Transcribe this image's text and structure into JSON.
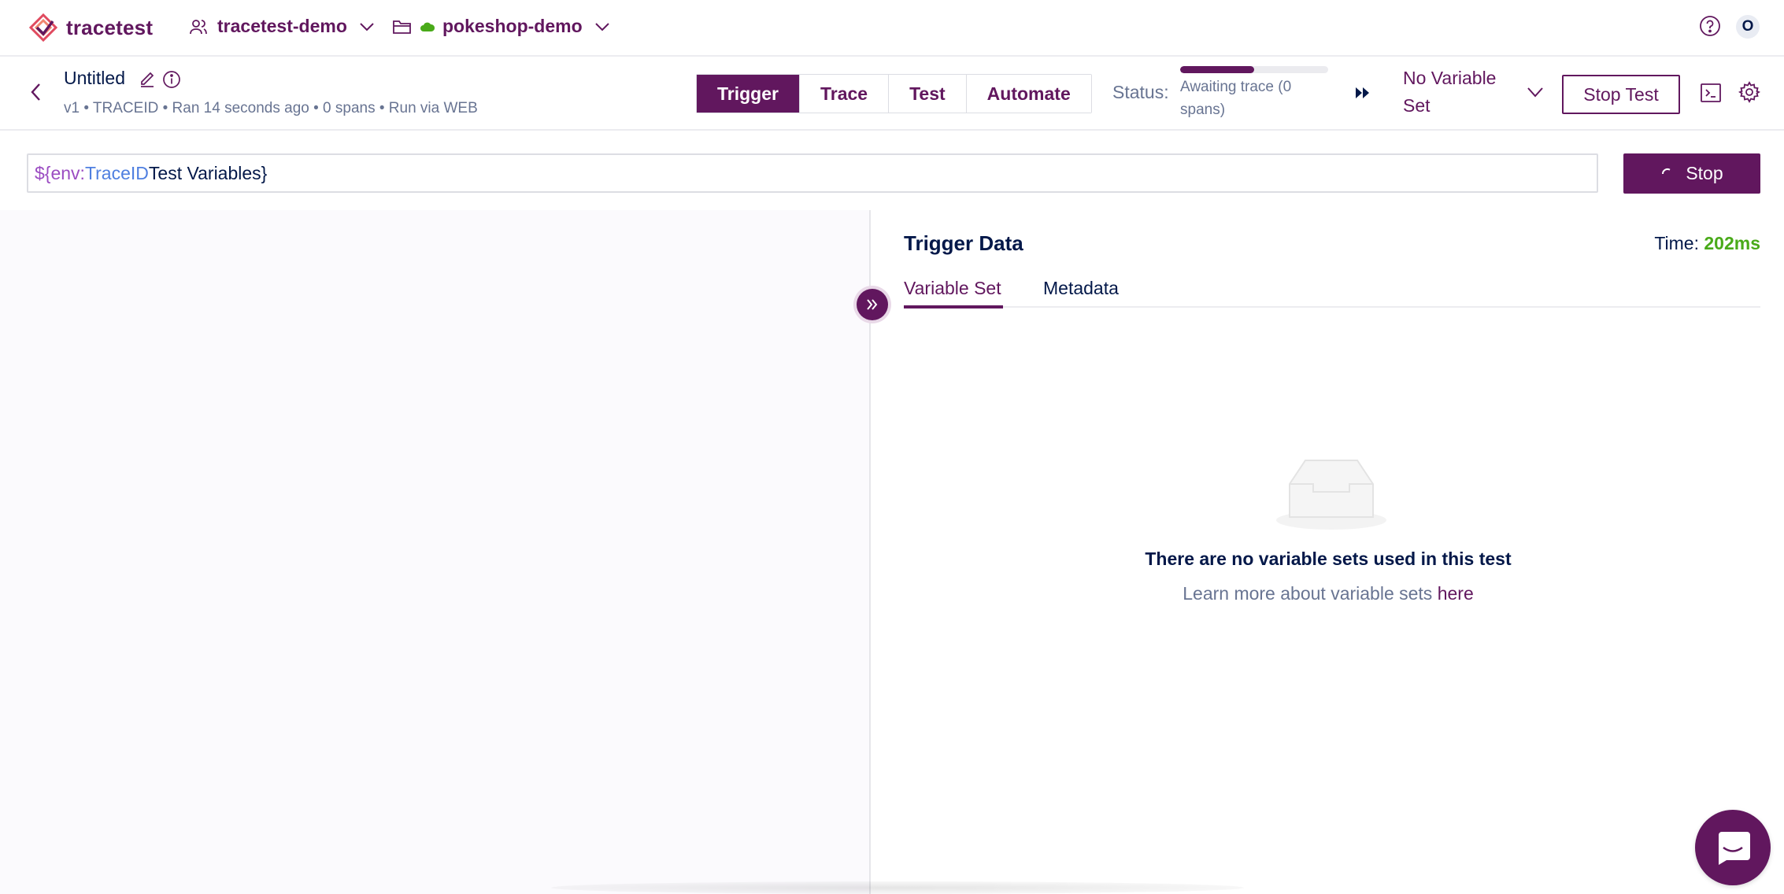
{
  "brand": {
    "name": "tracetest"
  },
  "nav": {
    "organization": "tracetest-demo",
    "environment": "pokeshop-demo",
    "avatar_initial": "O"
  },
  "test": {
    "name": "Untitled",
    "meta": "v1 • TRACEID • Ran 14 seconds ago • 0 spans • Run via WEB"
  },
  "modes": [
    {
      "label": "Trigger",
      "active": true
    },
    {
      "label": "Trace",
      "active": false
    },
    {
      "label": "Test",
      "active": false
    },
    {
      "label": "Automate",
      "active": false
    }
  ],
  "status": {
    "label": "Status:",
    "text": "Awaiting trace (0 spans)",
    "progress_fraction": 0.5
  },
  "variable_set": {
    "selected": "No Variable Set"
  },
  "actions": {
    "stop_test": "Stop Test",
    "stop": "Stop"
  },
  "url_bar": {
    "tokens": [
      {
        "text": "${env:",
        "kind": "env"
      },
      {
        "text": "TraceID",
        "kind": "trace"
      },
      {
        "text": " Test Variables}",
        "kind": "rest"
      }
    ]
  },
  "trigger_data": {
    "title": "Trigger Data",
    "time_label": "Time:",
    "time_value": "202ms",
    "tabs": [
      {
        "label": "Variable Set",
        "active": true
      },
      {
        "label": "Metadata",
        "active": false
      }
    ],
    "empty_title": "There are no variable sets used in this test",
    "empty_sub": "Learn more about variable sets ",
    "empty_link": "here"
  },
  "colors": {
    "brand": "#61175e",
    "text": "#031849",
    "muted": "#687492",
    "success": "#49aa19",
    "env_token": "#9b4cc2",
    "trace_token": "#4f7fe0"
  },
  "icons": [
    "logo-icon",
    "users-icon",
    "chevron-down-icon",
    "folder-icon",
    "cloud-icon",
    "help-icon",
    "back-icon",
    "edit-icon",
    "info-icon",
    "fast-forward-icon",
    "terminal-icon",
    "gear-icon",
    "spinner-icon",
    "expand-icon",
    "empty-inbox-icon",
    "chat-icon"
  ]
}
